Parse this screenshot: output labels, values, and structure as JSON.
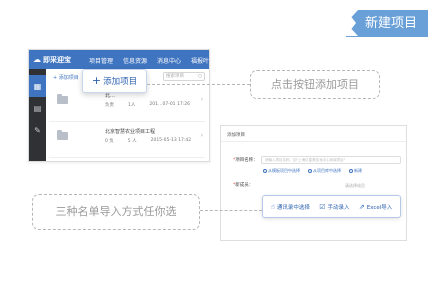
{
  "flag": {
    "label": "新建项目"
  },
  "app": {
    "logo": "即采迎宝",
    "nav": [
      "项目管理",
      "信息资源",
      "消息中心",
      "福报叶"
    ],
    "toolbar": {
      "add_label": "+ 添加项目",
      "search_placeholder": "搜索项目"
    },
    "rows": [
      {
        "title": "北…",
        "meta": [
          "负责",
          "1人",
          "201…07-01 17:26"
        ]
      },
      {
        "title": "北京智慧农业项目工程",
        "meta": [
          "0 负",
          "5 人",
          "2015-05-13 17:42"
        ]
      }
    ]
  },
  "add_popup": {
    "label": "添加项目"
  },
  "callouts": {
    "click_add": "点击按钮添加项目",
    "three_ways": "三种名单导入方式任你选"
  },
  "form": {
    "title": "添加项目",
    "project_name_label": "项目名称：",
    "project_name_placeholder": "请输入项目名称，如\"上海红星美凯龙中心商城项目\"",
    "options": [
      "从模板项目中选择",
      "从项目库中选择",
      "新建"
    ],
    "members_label": "新成员：",
    "members_hint": "请选择成员",
    "import_options": [
      {
        "icon": "hand-pointer-icon",
        "label": "通讯录中选择"
      },
      {
        "icon": "edit-icon",
        "label": "手动录入"
      },
      {
        "icon": "excel-icon",
        "label": "Excel导入"
      }
    ]
  }
}
